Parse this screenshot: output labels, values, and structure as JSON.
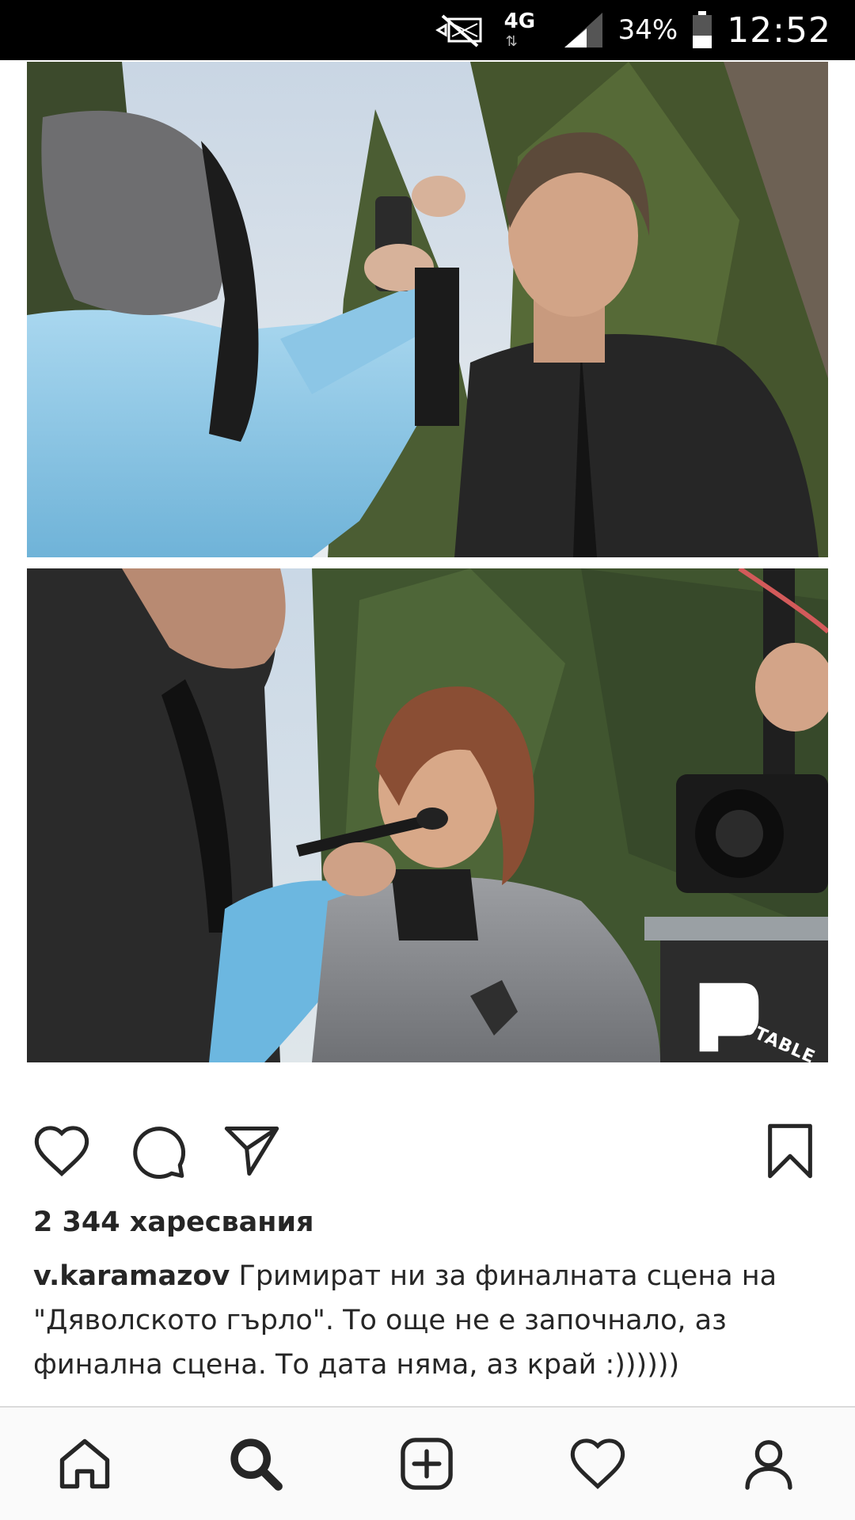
{
  "status_bar": {
    "network": "4G",
    "battery": "34%",
    "time": "12:52",
    "icons": [
      "mute-icon",
      "network-4g-icon",
      "signal-icon",
      "battery-icon"
    ]
  },
  "post": {
    "image": {
      "top_photo": "makeup-artist-spraying-actor-in-leather-jacket",
      "bottom_photo": "makeup-artist-brushing-actress-in-grey-jacket",
      "watermark": "PHOTABLE"
    },
    "actions": {
      "icons": [
        "heart-icon",
        "comment-icon",
        "share-icon",
        "bookmark-icon"
      ]
    },
    "likes": "2 344 харесвания",
    "caption": {
      "username": "v.karamazov",
      "text": " Гримират ни за финалната сцена на \"Дяволското гърло\". То още не е започнало, аз финална сцена. То дата няма, аз край :))))))"
    }
  },
  "bottom_nav": {
    "items": [
      {
        "name": "home",
        "icon": "home-icon"
      },
      {
        "name": "search",
        "icon": "search-icon"
      },
      {
        "name": "add",
        "icon": "add-post-icon"
      },
      {
        "name": "activity",
        "icon": "heart-icon"
      },
      {
        "name": "profile",
        "icon": "profile-icon"
      }
    ]
  },
  "colors": {
    "text": "#262626",
    "status_bar_bg": "#000000",
    "nav_bg": "#fafafa"
  }
}
